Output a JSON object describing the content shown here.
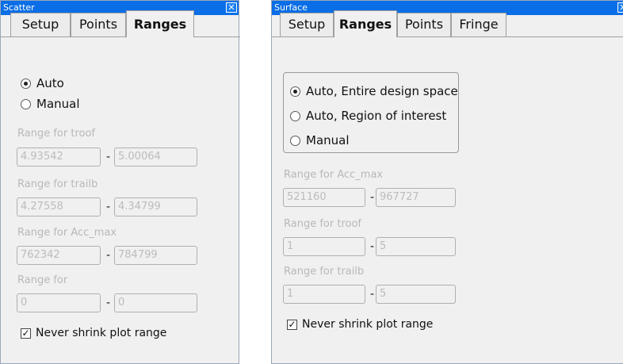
{
  "left": {
    "title": "Scatter",
    "tabs": [
      "Setup",
      "Points",
      "Ranges"
    ],
    "radios": [
      {
        "label": "Auto",
        "selected": true
      },
      {
        "label": "Manual",
        "selected": false
      }
    ],
    "ranges": [
      {
        "label": "Range for troof",
        "min": "4.93542",
        "max": "5.00064"
      },
      {
        "label": "Range for trailb",
        "min": "4.27558",
        "max": "4.34799"
      },
      {
        "label": "Range for Acc_max",
        "min": "762342",
        "max": "784799"
      },
      {
        "label": "Range for",
        "min": "0",
        "max": "0"
      }
    ],
    "dash": "-",
    "check_label": "Never shrink plot range",
    "check_checked": true
  },
  "right": {
    "title": "Surface",
    "tabs": [
      "Setup",
      "Ranges",
      "Points",
      "Fringe"
    ],
    "radios": [
      {
        "label": "Auto, Entire design space",
        "selected": true
      },
      {
        "label": "Auto, Region of interest",
        "selected": false
      },
      {
        "label": "Manual",
        "selected": false
      }
    ],
    "ranges": [
      {
        "label": "Range for Acc_max",
        "min": "521160",
        "max": "967727"
      },
      {
        "label": "Range for troof",
        "min": "1",
        "max": "5"
      },
      {
        "label": "Range for trailb",
        "min": "1",
        "max": "5"
      }
    ],
    "dash": "-",
    "check_label": "Never shrink plot range",
    "check_checked": true
  },
  "icons": {
    "close": "close-icon",
    "check": "checkmark-icon"
  }
}
